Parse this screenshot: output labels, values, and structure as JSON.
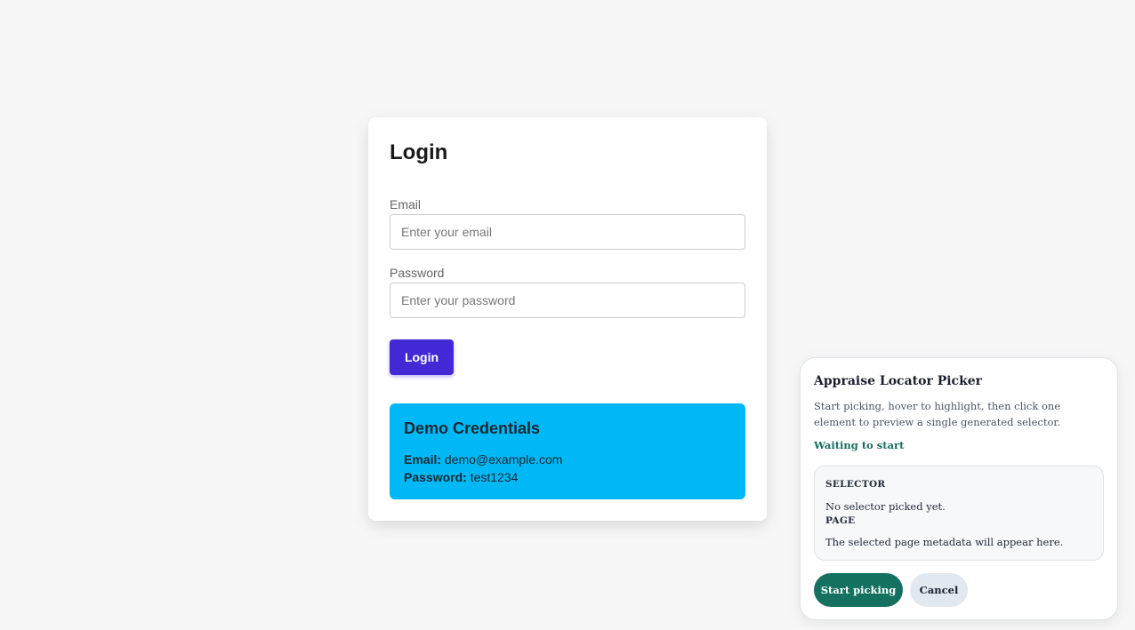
{
  "login": {
    "title": "Login",
    "email_label": "Email",
    "email_placeholder": "Enter your email",
    "email_value": "",
    "password_label": "Password",
    "password_placeholder": "Enter your password",
    "password_value": "",
    "button_label": "Login"
  },
  "demo": {
    "title": "Demo Credentials",
    "email_label": "Email:",
    "email_value": "demo@example.com",
    "password_label": "Password:",
    "password_value": "test1234"
  },
  "picker": {
    "title": "Appraise Locator Picker",
    "description": "Start picking, hover to highlight, then click one element to preview a single generated selector.",
    "status": "Waiting to start",
    "selector_label": "SELECTOR",
    "selector_value": "No selector picked yet.",
    "page_label": "PAGE",
    "page_value": "The selected page metadata will appear here.",
    "start_label": "Start picking",
    "cancel_label": "Cancel"
  },
  "colors": {
    "background": "#f7f7f7",
    "login_button": "#4328d6",
    "demo_box": "#00b8f5",
    "picker_accent": "#14705f",
    "cancel_button": "#e2e8f0"
  }
}
